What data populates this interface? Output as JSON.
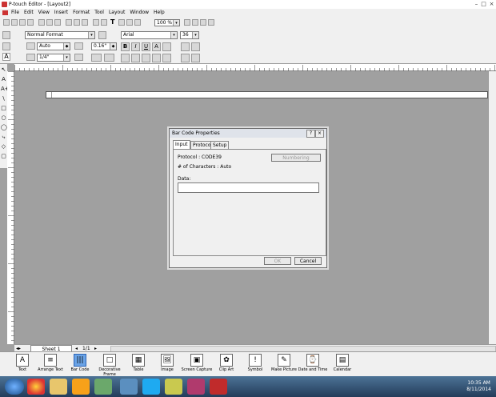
{
  "window": {
    "title": "P-touch Editor - [Layout2]"
  },
  "menu": [
    "File",
    "Edit",
    "View",
    "Insert",
    "Format",
    "Tool",
    "Layout",
    "Window",
    "Help"
  ],
  "toolbar": {
    "zoom": "100 %",
    "text_tool": "T"
  },
  "format_bar": {
    "layout_format": "Normal Format",
    "length": "Auto",
    "margin": "0.16\"",
    "tape_width": "1/4\"",
    "font": "Arial",
    "font_size": "36",
    "bold": "B",
    "italic": "I",
    "underline": "U",
    "outline": "A"
  },
  "left_tools": [
    "↖",
    "A",
    "A+",
    "\\",
    "□",
    "○",
    "◯",
    "⤷",
    "◇",
    "▢"
  ],
  "dialog": {
    "title": "Bar Code Properties",
    "help": "?",
    "tabs": [
      "Input",
      "Protocol",
      "Setup"
    ],
    "protocol_line": "Protocol : CODE39",
    "chars_line": "# of Characters : Auto",
    "numbering": "Numbering",
    "data_label": "Data:",
    "data_value": "",
    "ok": "OK",
    "cancel": "Cancel"
  },
  "sheet": {
    "tab": "Sheet 1",
    "pages": "1/1"
  },
  "bottom_tools": [
    {
      "icon": "A",
      "label": "Text"
    },
    {
      "icon": "≡",
      "label": "Arrange Text"
    },
    {
      "icon": "|||",
      "label": "Bar Code"
    },
    {
      "icon": "□",
      "label": "Decorative Frame"
    },
    {
      "icon": "▦",
      "label": "Table"
    },
    {
      "icon": "🖼",
      "label": "Image"
    },
    {
      "icon": "▣",
      "label": "Screen Capture"
    },
    {
      "icon": "✿",
      "label": "Clip Art"
    },
    {
      "icon": "!",
      "label": "Symbol"
    },
    {
      "icon": "✎",
      "label": "Make Picture"
    },
    {
      "icon": "⌚",
      "label": "Date and Time"
    },
    {
      "icon": "▤",
      "label": "Calendar"
    }
  ],
  "clock": {
    "time": "10:35 AM",
    "date": "8/11/2014"
  }
}
